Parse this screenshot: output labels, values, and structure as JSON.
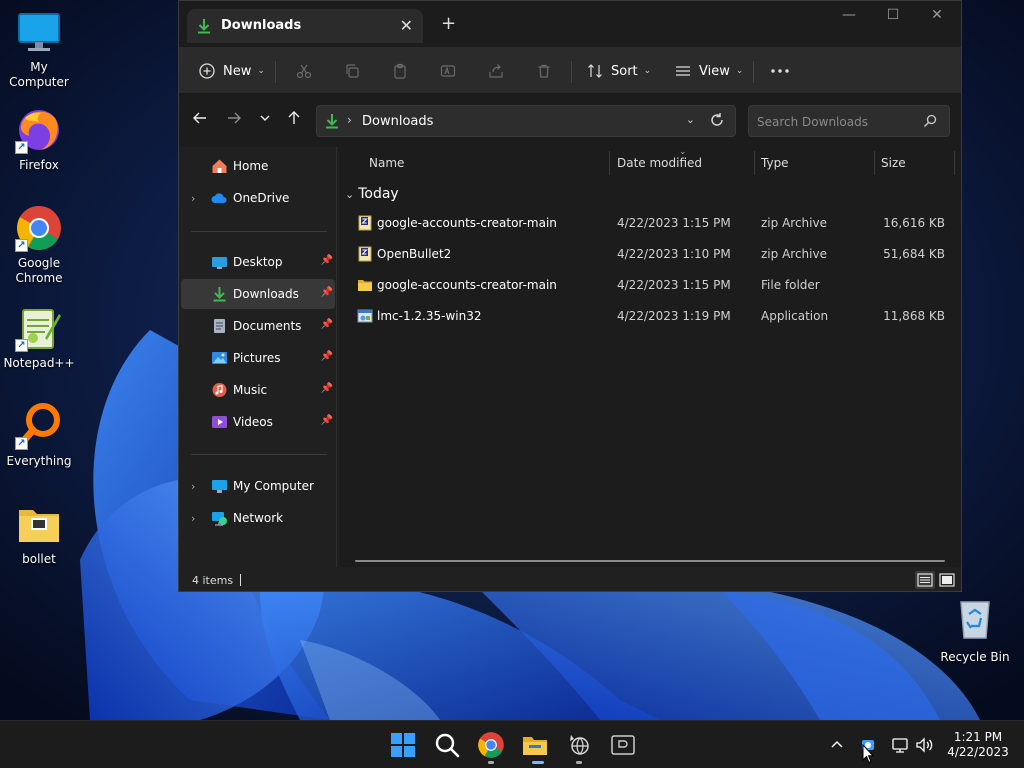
{
  "desktop": {
    "icons": [
      {
        "label": "My Computer",
        "icon": "monitor-icon"
      },
      {
        "label": "Firefox",
        "icon": "firefox-icon"
      },
      {
        "label": "Google Chrome",
        "icon": "chrome-icon"
      },
      {
        "label": "Notepad++",
        "icon": "notepadpp-icon"
      },
      {
        "label": "Everything",
        "icon": "everything-search-icon"
      },
      {
        "label": "bollet",
        "icon": "folder-icon"
      }
    ],
    "recycle_bin": "Recycle Bin"
  },
  "window": {
    "tab_title": "Downloads",
    "toolbar": {
      "new_label": "New",
      "sort_label": "Sort",
      "view_label": "View"
    },
    "address": {
      "path": "Downloads",
      "search_placeholder": "Search Downloads"
    },
    "nav": {
      "items": [
        {
          "label": "Home"
        },
        {
          "label": "OneDrive"
        },
        {
          "label": "Desktop"
        },
        {
          "label": "Downloads"
        },
        {
          "label": "Documents"
        },
        {
          "label": "Pictures"
        },
        {
          "label": "Music"
        },
        {
          "label": "Videos"
        },
        {
          "label": "My Computer"
        },
        {
          "label": "Network"
        }
      ]
    },
    "columns": {
      "name": "Name",
      "date": "Date modified",
      "type": "Type",
      "size": "Size"
    },
    "group": "Today",
    "files": [
      {
        "name": "google-accounts-creator-main",
        "date": "4/22/2023 1:15 PM",
        "type": "zip Archive",
        "size": "16,616 KB",
        "icon": "zip-icon"
      },
      {
        "name": "OpenBullet2",
        "date": "4/22/2023 1:10 PM",
        "type": "zip Archive",
        "size": "51,684 KB",
        "icon": "zip-icon"
      },
      {
        "name": "google-accounts-creator-main",
        "date": "4/22/2023 1:15 PM",
        "type": "File folder",
        "size": "",
        "icon": "folder-icon"
      },
      {
        "name": "lmc-1.2.35-win32",
        "date": "4/22/2023 1:19 PM",
        "type": "Application",
        "size": "11,868 KB",
        "icon": "application-icon"
      }
    ],
    "status": "4 items"
  },
  "taskbar": {
    "time": "1:21 PM",
    "date": "4/22/2023"
  },
  "colors": {
    "accent_green": "#3fb950",
    "folder_yellow": "#f2c14e",
    "window_bg": "#202020"
  }
}
